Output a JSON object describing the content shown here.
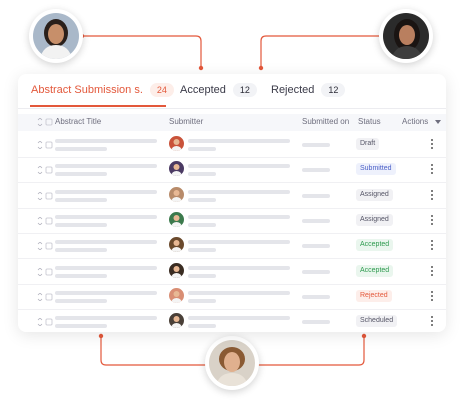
{
  "tabs": [
    {
      "label": "Abstract Submission s.",
      "count": "24",
      "active": true
    },
    {
      "label": "Accepted",
      "count": "12",
      "active": false
    },
    {
      "label": "Rejected",
      "count": "12",
      "active": false
    }
  ],
  "columns": {
    "title": "Abstract Title",
    "submitter": "Submitter",
    "submitted_on": "Submitted on",
    "status": "Status",
    "actions": "Actions"
  },
  "rows": [
    {
      "status": "Draft",
      "status_bg": "#f1f1f4",
      "status_fg": "#555566",
      "avatar_bg": "#c9533a"
    },
    {
      "status": "Submitted",
      "status_bg": "#eef1fc",
      "status_fg": "#4a5fc7",
      "avatar_bg": "#4b3a63"
    },
    {
      "status": "Assigned",
      "status_bg": "#f1f1f4",
      "status_fg": "#555566",
      "avatar_bg": "#b88b6a"
    },
    {
      "status": "Assigned",
      "status_bg": "#f1f1f4",
      "status_fg": "#555566",
      "avatar_bg": "#3c7a4d"
    },
    {
      "status": "Accepted",
      "status_bg": "#eaf6ee",
      "status_fg": "#2d9a4e",
      "avatar_bg": "#6b4a2d"
    },
    {
      "status": "Accepted",
      "status_bg": "#eaf6ee",
      "status_fg": "#2d9a4e",
      "avatar_bg": "#3a2c22"
    },
    {
      "status": "Rejected",
      "status_bg": "#fdeeea",
      "status_fg": "#e3583b",
      "avatar_bg": "#d98e74"
    },
    {
      "status": "Scheduled",
      "status_bg": "#f1f1f4",
      "status_fg": "#555566",
      "avatar_bg": "#4a4038"
    }
  ],
  "colors": {
    "accent": "#e3583b",
    "placeholder": "#e4e5ea"
  },
  "icons": [
    "user-avatar-icon",
    "kebab-menu-icon",
    "sort-icon",
    "checkbox-icon"
  ]
}
